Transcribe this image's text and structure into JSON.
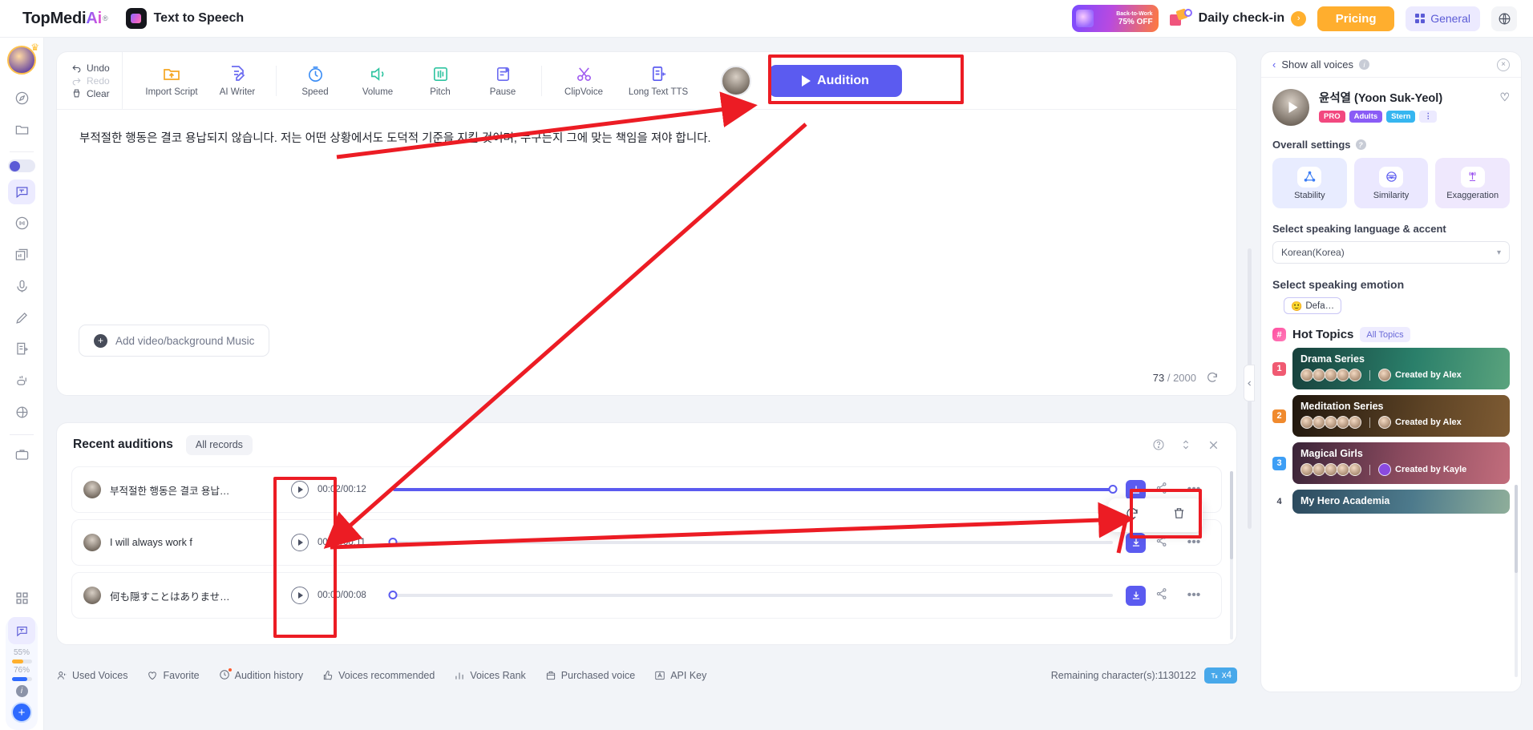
{
  "header": {
    "brand_main": "TopMedi",
    "brand_ai": "Ai",
    "brand_reg": "®",
    "product": "Text to Speech",
    "promo_line1": "Back-to-Work",
    "promo_line2": "75% OFF",
    "checkin": "Daily check-in",
    "checkin_arrow": "›",
    "pricing": "Pricing",
    "general": "General",
    "globe_icon": "globe-icon"
  },
  "rail": {
    "pct_top": "55%",
    "pct_bottom": "76%",
    "bar_top_color": "#ffb02e",
    "bar_bottom_color": "#2f6bff",
    "plus": "+",
    "info": "i"
  },
  "toolbar": {
    "undo": "Undo",
    "redo": "Redo",
    "clear": "Clear",
    "items": [
      {
        "label": "Import Script",
        "icon": "import-script-icon"
      },
      {
        "label": "AI Writer",
        "icon": "ai-writer-icon"
      },
      {
        "label": "Speed",
        "icon": "speed-icon"
      },
      {
        "label": "Volume",
        "icon": "volume-icon"
      },
      {
        "label": "Pitch",
        "icon": "pitch-icon"
      },
      {
        "label": "Pause",
        "icon": "pause-icon"
      },
      {
        "label": "ClipVoice",
        "icon": "clipvoice-icon"
      },
      {
        "label": "Long Text TTS",
        "icon": "long-text-tts-icon"
      }
    ],
    "audition": "Audition"
  },
  "editor": {
    "script": "부적절한 행동은 결코 용납되지 않습니다. 저는 어떤 상황에서도 도덕적 기준을 지킬 것이며, 누구든지 그에 맞는 책임을 져야 합니다.",
    "add_media": "Add video/background Music",
    "chars_used": "73",
    "chars_sep": "/ 2000"
  },
  "auditions": {
    "title": "Recent auditions",
    "all_records": "All records",
    "rows": [
      {
        "text": "부적절한 행동은 결코 용납되…",
        "time": "00:02/00:12",
        "progress": 100
      },
      {
        "text": "I will always work f",
        "time": "00:00/00:11",
        "progress": 0
      },
      {
        "text": "何も隠すことはありません 私",
        "time": "00:00/00:08",
        "progress": 0
      }
    ],
    "popover": {
      "refresh": "refresh-icon",
      "delete": "trash-icon"
    }
  },
  "bottom": {
    "items": [
      {
        "label": "Used Voices",
        "icon": "used-voices-icon"
      },
      {
        "label": "Favorite",
        "icon": "heart-icon"
      },
      {
        "label": "Audition history",
        "icon": "history-icon"
      },
      {
        "label": "Voices recommended",
        "icon": "thumbs-up-icon"
      },
      {
        "label": "Voices Rank",
        "icon": "rank-icon"
      },
      {
        "label": "Purchased voice",
        "icon": "purchase-icon"
      },
      {
        "label": "API Key",
        "icon": "api-key-icon"
      }
    ],
    "remaining": "Remaining character(s):1130122",
    "multiplier": "x4"
  },
  "right_panel": {
    "back_label": "Show all voices",
    "close": "×",
    "voice_name": "윤석열 (Yoon Suk-Yeol)",
    "tags": [
      "PRO",
      "Adults",
      "Stern"
    ],
    "tag_more": "⋮",
    "overall_settings": "Overall settings",
    "tiles": [
      {
        "label": "Stability",
        "icon": "stability-icon"
      },
      {
        "label": "Similarity",
        "icon": "similarity-icon"
      },
      {
        "label": "Exaggeration",
        "icon": "exaggeration-icon"
      }
    ],
    "language_label": "Select speaking language & accent",
    "language_value": "Korean(Korea)",
    "emotion_label": "Select speaking emotion",
    "emotion_value": "Defa…",
    "emotion_emoji": "🙂",
    "hot_topics": "Hot Topics",
    "all_topics": "All Topics",
    "topics": [
      {
        "rank": "1",
        "title": "Drama Series",
        "creator": "Created by Alex",
        "color": "#1e5f58"
      },
      {
        "rank": "2",
        "title": "Meditation Series",
        "creator": "Created by Alex",
        "color": "#4a3520"
      },
      {
        "rank": "3",
        "title": "Magical Girls",
        "creator": "Created by Kayle",
        "color": "#5a3a6a"
      },
      {
        "rank": "4",
        "title": "My Hero Academia",
        "creator": "",
        "color": "#3b5a70"
      }
    ]
  }
}
